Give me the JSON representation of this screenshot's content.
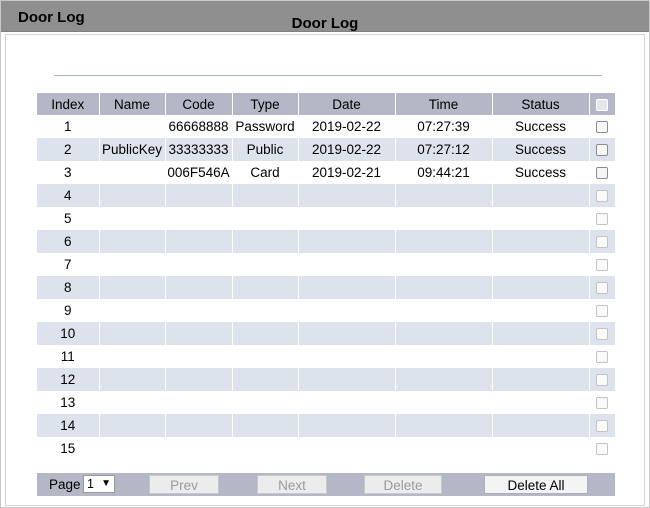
{
  "window": {
    "title": "Door Log"
  },
  "section": {
    "title": "Door Log"
  },
  "table": {
    "headers": [
      "Index",
      "Name",
      "Code",
      "Type",
      "Date",
      "Time",
      "Status"
    ],
    "rows": [
      {
        "index": "1",
        "name": "",
        "code": "66668888",
        "type": "Password",
        "date": "2019-02-22",
        "time": "07:27:39",
        "status": "Success",
        "enabled": true
      },
      {
        "index": "2",
        "name": "PublicKey",
        "code": "33333333",
        "type": "Public",
        "date": "2019-02-22",
        "time": "07:27:12",
        "status": "Success",
        "enabled": true
      },
      {
        "index": "3",
        "name": "",
        "code": "006F546A",
        "type": "Card",
        "date": "2019-02-21",
        "time": "09:44:21",
        "status": "Success",
        "enabled": true
      },
      {
        "index": "4",
        "name": "",
        "code": "",
        "type": "",
        "date": "",
        "time": "",
        "status": "",
        "enabled": false
      },
      {
        "index": "5",
        "name": "",
        "code": "",
        "type": "",
        "date": "",
        "time": "",
        "status": "",
        "enabled": false
      },
      {
        "index": "6",
        "name": "",
        "code": "",
        "type": "",
        "date": "",
        "time": "",
        "status": "",
        "enabled": false
      },
      {
        "index": "7",
        "name": "",
        "code": "",
        "type": "",
        "date": "",
        "time": "",
        "status": "",
        "enabled": false
      },
      {
        "index": "8",
        "name": "",
        "code": "",
        "type": "",
        "date": "",
        "time": "",
        "status": "",
        "enabled": false
      },
      {
        "index": "9",
        "name": "",
        "code": "",
        "type": "",
        "date": "",
        "time": "",
        "status": "",
        "enabled": false
      },
      {
        "index": "10",
        "name": "",
        "code": "",
        "type": "",
        "date": "",
        "time": "",
        "status": "",
        "enabled": false
      },
      {
        "index": "11",
        "name": "",
        "code": "",
        "type": "",
        "date": "",
        "time": "",
        "status": "",
        "enabled": false
      },
      {
        "index": "12",
        "name": "",
        "code": "",
        "type": "",
        "date": "",
        "time": "",
        "status": "",
        "enabled": false
      },
      {
        "index": "13",
        "name": "",
        "code": "",
        "type": "",
        "date": "",
        "time": "",
        "status": "",
        "enabled": false
      },
      {
        "index": "14",
        "name": "",
        "code": "",
        "type": "",
        "date": "",
        "time": "",
        "status": "",
        "enabled": false
      },
      {
        "index": "15",
        "name": "",
        "code": "",
        "type": "",
        "date": "",
        "time": "",
        "status": "",
        "enabled": false
      }
    ]
  },
  "pagination": {
    "page_label": "Page",
    "page_value": "1",
    "arrow": "▼",
    "prev_label": "Prev",
    "next_label": "Next",
    "delete_label": "Delete",
    "delete_all_label": "Delete All"
  }
}
